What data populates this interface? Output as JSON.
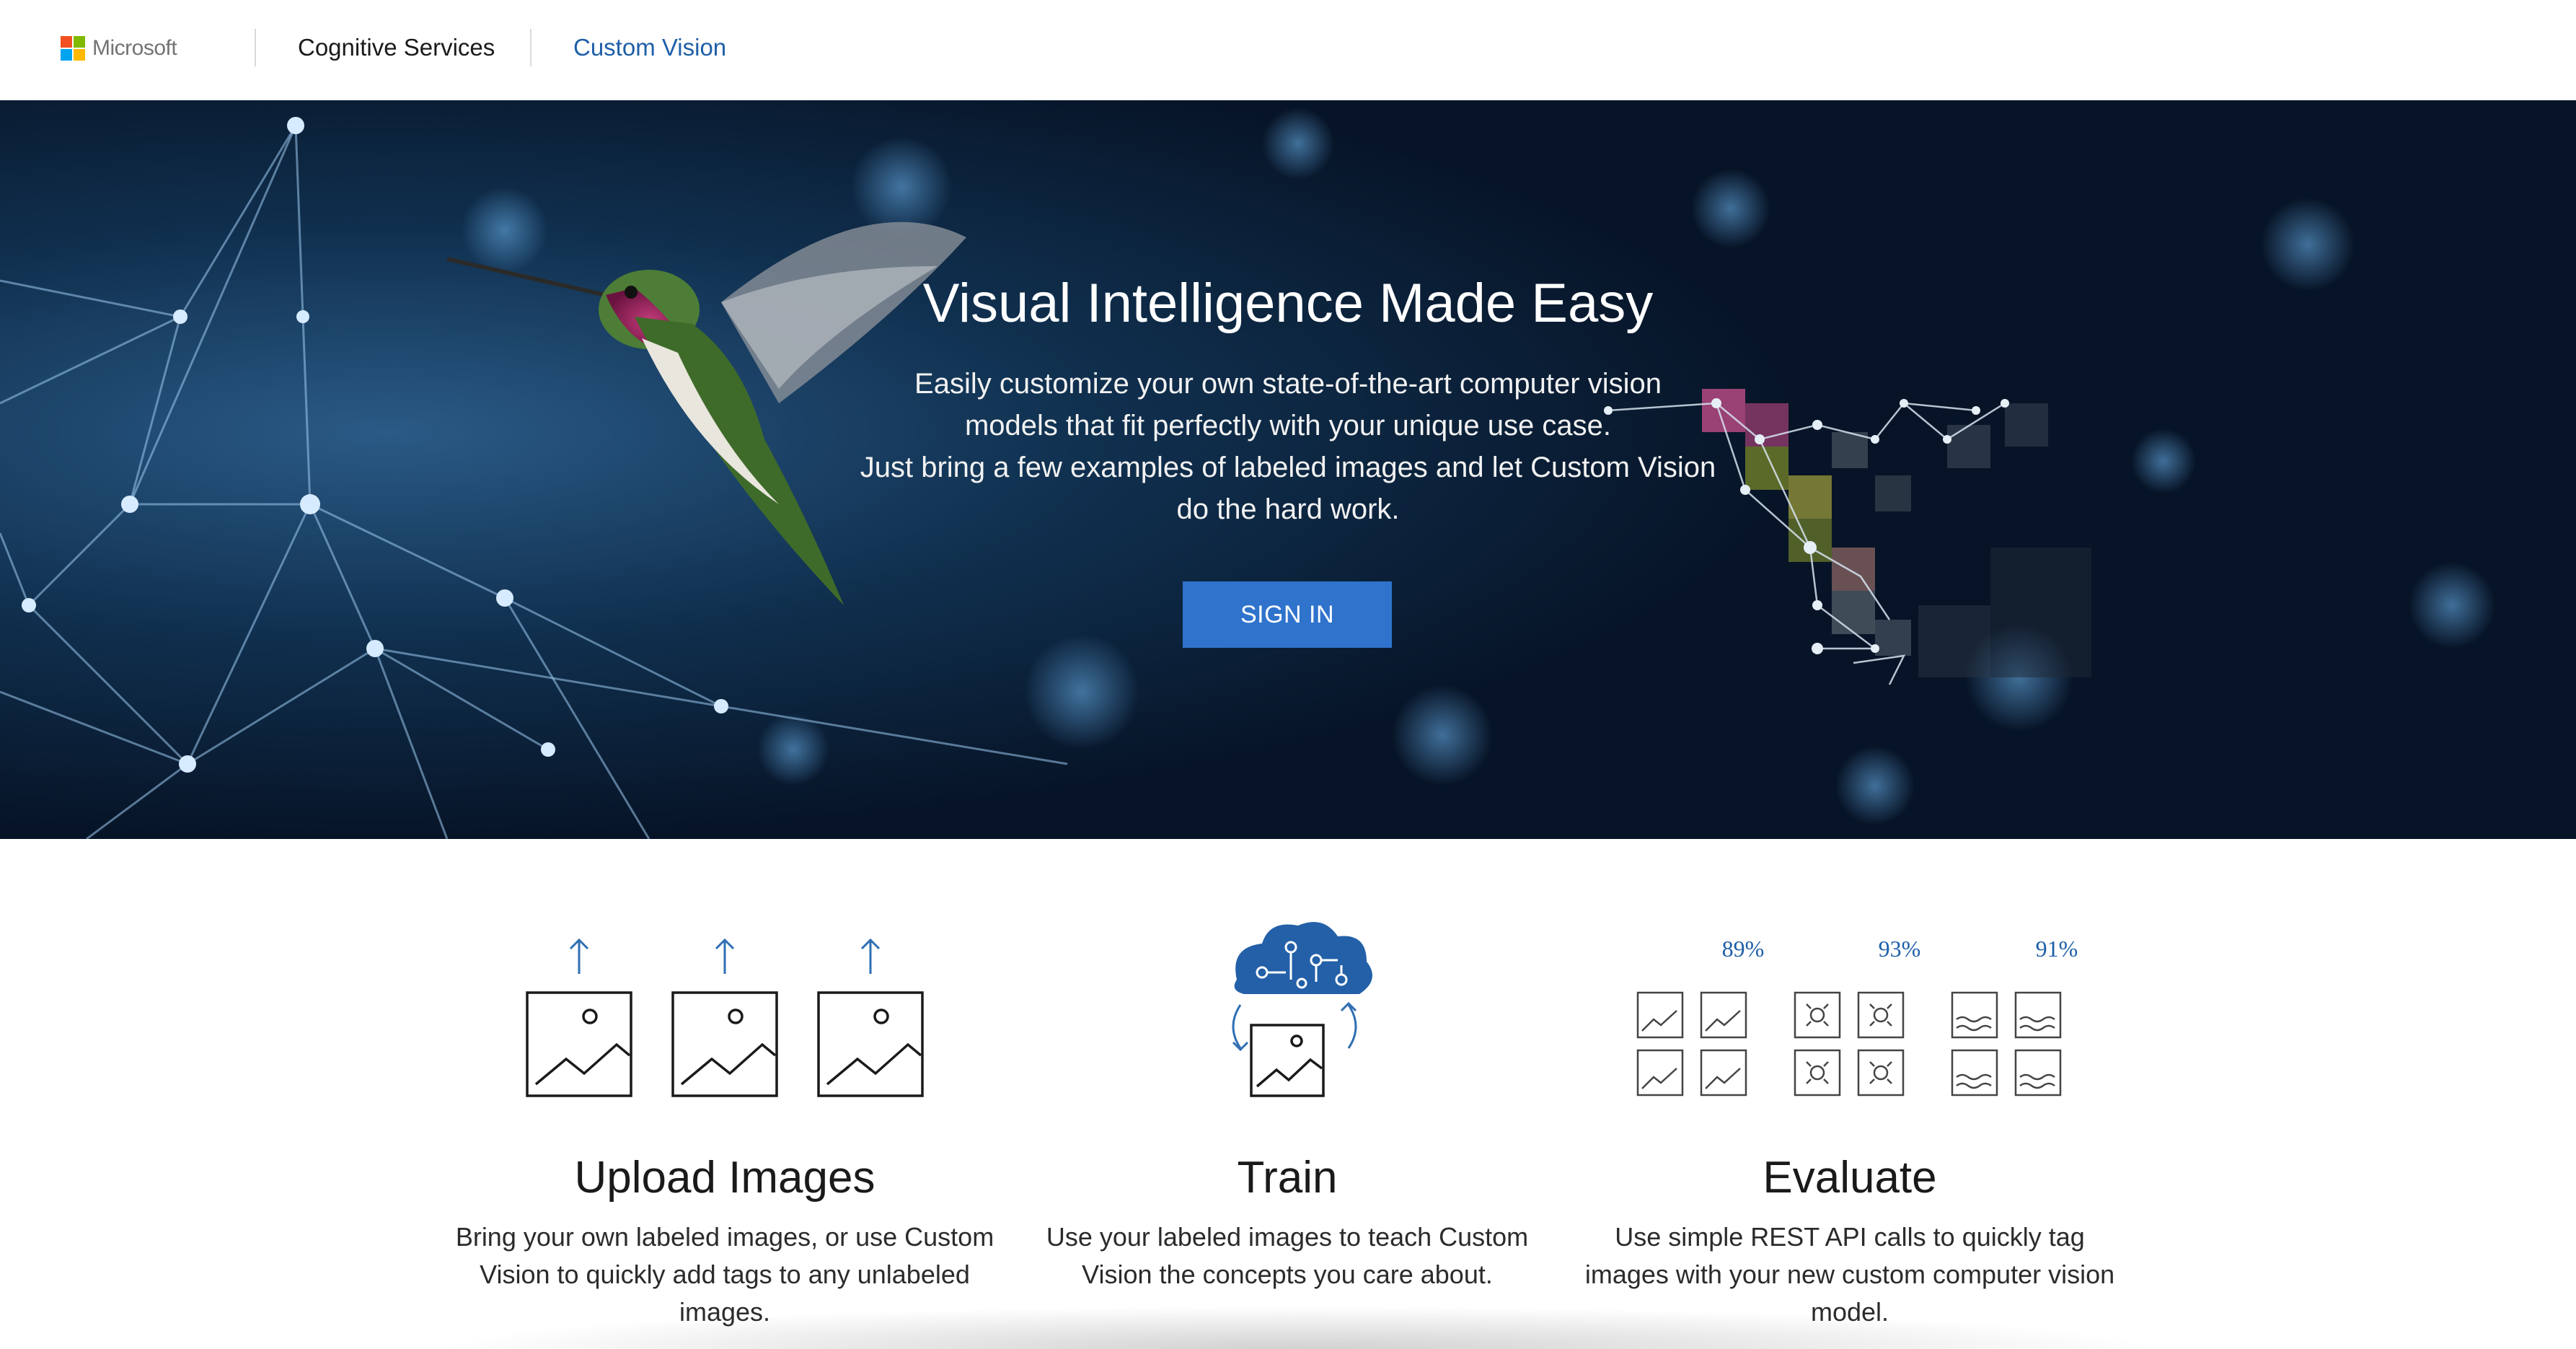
{
  "header": {
    "brand": "Microsoft",
    "brand_colors": [
      "#f25022",
      "#7fba00",
      "#00a4ef",
      "#ffb900"
    ],
    "nav": [
      {
        "label": "Cognitive Services"
      },
      {
        "label": "Custom Vision"
      }
    ],
    "active_color": "#1e5fa8"
  },
  "hero": {
    "title": "Visual Intelligence Made Easy",
    "subtitle_lines": [
      "Easily customize your own state-of-the-art computer vision",
      "models that fit perfectly with your unique use case.",
      "Just bring a few examples of labeled images and let Custom Vision",
      "do the hard work."
    ],
    "cta": "SIGN IN",
    "cta_color": "#2f73cc"
  },
  "features": [
    {
      "icon": "upload-images-icon",
      "title": "Upload Images",
      "description": "Bring your own labeled images, or use Custom Vision to quickly add tags to any unlabeled images."
    },
    {
      "icon": "train-brain-icon",
      "title": "Train",
      "description": "Use your labeled images to teach Custom Vision the concepts you care about."
    },
    {
      "icon": "evaluate-icon",
      "title": "Evaluate",
      "description": "Use simple REST API calls to quickly tag images with your new custom computer vision model.",
      "scores": [
        "89%",
        "93%",
        "91%"
      ]
    }
  ]
}
